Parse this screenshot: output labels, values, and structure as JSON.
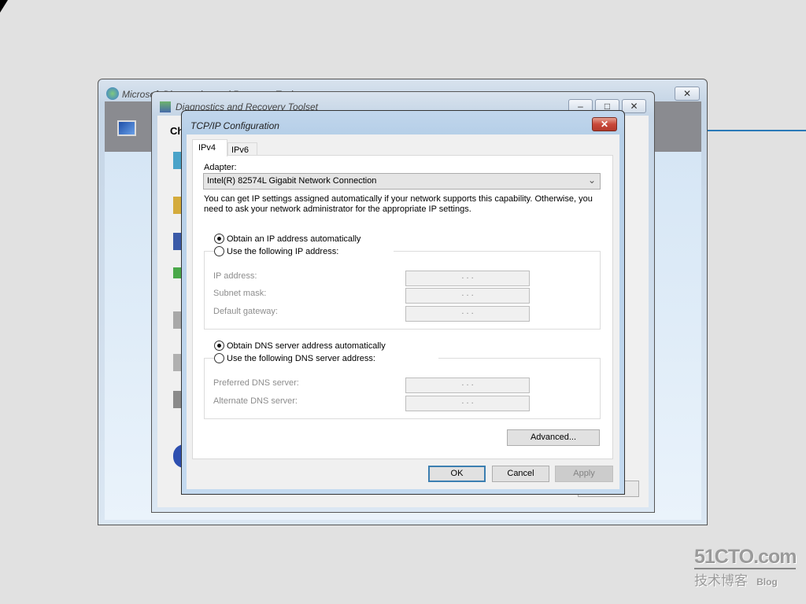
{
  "back_window": {
    "title": "Microsoft Diagnostics and Recovery Toolset",
    "close": "✕"
  },
  "middle_window": {
    "title": "Diagnostics and Recovery Toolset",
    "heading": "Ch",
    "minimize": "–",
    "maximize": "□",
    "close": "✕"
  },
  "dialog": {
    "title": "TCP/IP Configuration",
    "close": "✕",
    "tabs": [
      {
        "label": "IPv4",
        "selected": true
      },
      {
        "label": "IPv6",
        "selected": false
      }
    ],
    "adapter_label": "Adapter:",
    "adapter_value": "Intel(R) 82574L Gigabit Network Connection",
    "description_line1": "You can get IP settings assigned automatically if your network supports this capability. Otherwise, you",
    "description_line2": "need to ask your network administrator for the appropriate IP settings.",
    "ip_auto": {
      "label": "Obtain an IP address automatically",
      "checked": true
    },
    "ip_manual": {
      "label": "Use the following IP address:",
      "checked": false
    },
    "ip_fields": [
      {
        "label": "IP address:",
        "value": ".       .       ."
      },
      {
        "label": "Subnet mask:",
        "value": ".       .       ."
      },
      {
        "label": "Default gateway:",
        "value": ".       .       ."
      }
    ],
    "dns_auto": {
      "label": "Obtain DNS server address automatically",
      "checked": true
    },
    "dns_manual": {
      "label": "Use the following DNS server address:",
      "checked": false
    },
    "dns_fields": [
      {
        "label": "Preferred DNS server:",
        "value": ".       .       ."
      },
      {
        "label": "Alternate DNS server:",
        "value": ".       .       ."
      }
    ],
    "advanced": "Advanced...",
    "ok": "OK",
    "cancel": "Cancel",
    "apply": "Apply"
  },
  "watermark": {
    "logo": "51CTO.com",
    "sub": "技术博客",
    "blog": "Blog"
  },
  "colors": {
    "accent": "#3c7fb1",
    "close_red": "#c9483a",
    "desktop": "#e1e1e1"
  }
}
